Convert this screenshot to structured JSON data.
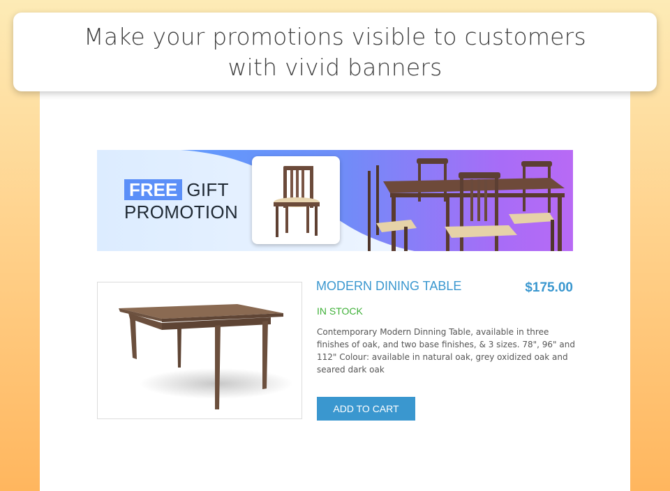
{
  "headline": {
    "line1": "Make your promotions visible to customers",
    "line2": "with vivid banners"
  },
  "banner": {
    "badge": "FREE",
    "gift": "GIFT",
    "promotion": "PROMOTION"
  },
  "product": {
    "title": "MODERN DINING TABLE",
    "price": "$175.00",
    "stock": "IN STOCK",
    "description": "Contemporary Modern Dinning Table, available in three finishes of oak, and two base finishes, & 3 sizes. 78\", 96\" and 112\" Colour: available in natural oak, grey oxidized oak and seared dark oak",
    "add_to_cart": "ADD TO CART"
  },
  "colors": {
    "accent": "#3a97cf",
    "in_stock": "#3fb038",
    "badge": "#5b8ff8"
  }
}
